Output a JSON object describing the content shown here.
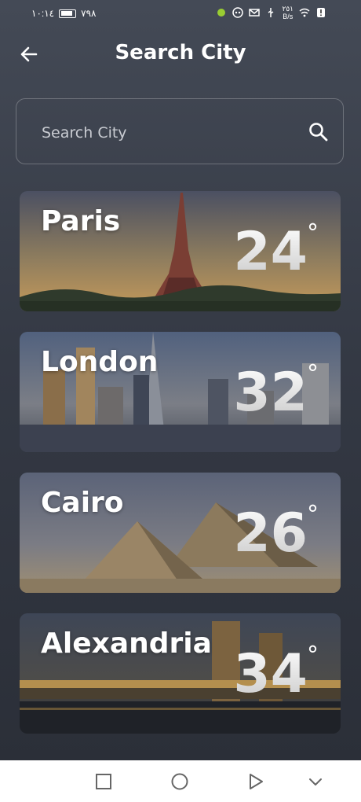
{
  "status_bar": {
    "time": "١٠:١٤",
    "battery": "٧٩٨",
    "net_speed_value": "٢٥١",
    "net_speed_unit": "B/s"
  },
  "header": {
    "title": "Search City"
  },
  "search": {
    "placeholder": "Search City"
  },
  "cities": [
    {
      "name": "Paris",
      "temp": "24",
      "degree": "°"
    },
    {
      "name": "London",
      "temp": "32",
      "degree": "°"
    },
    {
      "name": "Cairo",
      "temp": "26",
      "degree": "°"
    },
    {
      "name": "Alexandria",
      "temp": "34",
      "degree": "°"
    }
  ],
  "icons": {
    "back": "arrow-left-icon",
    "search": "search-icon",
    "nav": [
      "square-recents-icon",
      "circle-home-icon",
      "triangle-back-icon",
      "chevron-down-icon"
    ]
  },
  "colors": {
    "background": "#3a3f4a",
    "text": "#ffffff",
    "nav_bar": "#ffffff"
  }
}
